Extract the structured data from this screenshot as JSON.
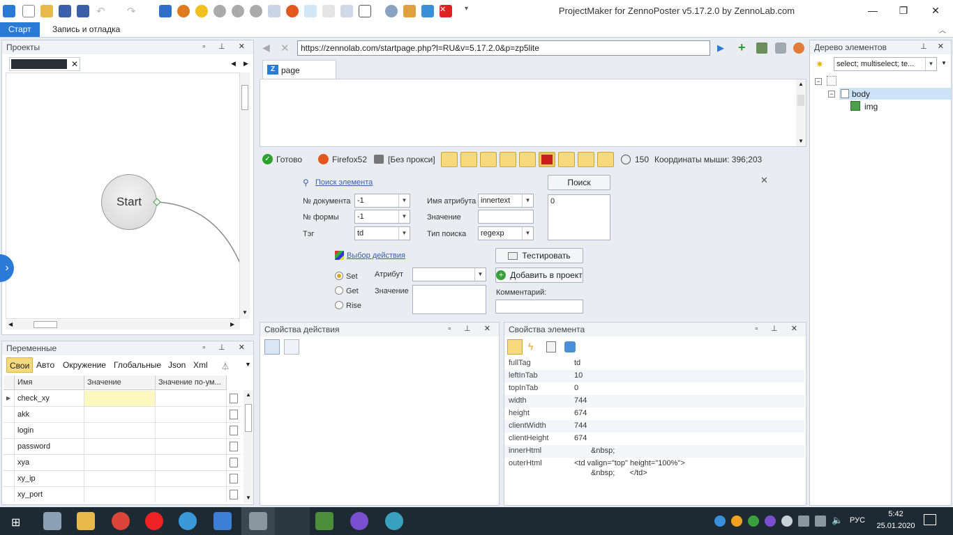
{
  "window": {
    "title": "ProjectMaker for ZennoPoster v5.17.2.0 by ZennoLab.com",
    "minimize": "—",
    "maximize": "❐",
    "close": "✕"
  },
  "ribbon": {
    "tabs": [
      "Старт",
      "Запись и отладка"
    ]
  },
  "projects": {
    "title": "Проекты",
    "start_node": "Start"
  },
  "variables": {
    "title": "Переменные",
    "tabs": [
      "Свои",
      "Авто",
      "Окружение",
      "Глобальные",
      "Json",
      "Xml"
    ],
    "columns": [
      "Имя",
      "Значение",
      "Значение по-ум..."
    ],
    "rows": [
      "check_xy",
      "akk",
      "login",
      "password",
      "xya",
      "xy_ip",
      "xy_port"
    ]
  },
  "browser": {
    "url": "https://zennolab.com/startpage.php?l=RU&v=5.17.2.0&p=zp5lite",
    "tab_label": "page"
  },
  "statusbar": {
    "ready": "Готово",
    "browser": "Firefox52",
    "proxy": "[Без прокси]",
    "counter": "150",
    "coords": "Координаты мыши: 396;203"
  },
  "search": {
    "find_link": "Поиск элемента",
    "doc_label": "№ документа",
    "doc_value": "-1",
    "form_label": "№ формы",
    "form_value": "-1",
    "tag_label": "Тэг",
    "tag_value": "td",
    "attr_name_label": "Имя атрибута",
    "attr_name_value": "innertext",
    "value_label": "Значение",
    "value_value": "",
    "search_type_label": "Тип поиска",
    "search_type_value": "regexp",
    "search_button": "Поиск",
    "result_value": "0",
    "action_link": "Выбор действия",
    "radio_set": "Set",
    "radio_get": "Get",
    "radio_rise": "Rise",
    "attr_label": "Атрибут",
    "action_value_label": "Значение",
    "test_button": "Тестировать",
    "add_button": "Добавить в проект",
    "comment_label": "Комментарий:"
  },
  "action_props": {
    "title": "Свойства действия"
  },
  "element_props": {
    "title": "Свойства элемента",
    "rows": [
      {
        "k": "fullTag",
        "v": "td"
      },
      {
        "k": "leftInTab",
        "v": "10"
      },
      {
        "k": "topInTab",
        "v": "0"
      },
      {
        "k": "width",
        "v": "744"
      },
      {
        "k": "height",
        "v": "674"
      },
      {
        "k": "clientWidth",
        "v": "744"
      },
      {
        "k": "clientHeight",
        "v": "674"
      },
      {
        "k": "innerHtml",
        "v": "&nbsp;"
      },
      {
        "k": "outerHtml",
        "v": "<td valign=\"top\" height=\"100%\">"
      }
    ],
    "outer_line2": "&nbsp;       </td>"
  },
  "tree": {
    "title": "Дерево элементов",
    "filter": "select; multiselect; te...",
    "nodes": [
      "body",
      "img"
    ]
  },
  "taskbar": {
    "lang": "РУС",
    "time": "5:42",
    "date": "25.01.2020"
  },
  "colors": {
    "accent": "#2a7bd5",
    "highlight": "#f6d97a",
    "taskbar": "#1e2a33"
  }
}
